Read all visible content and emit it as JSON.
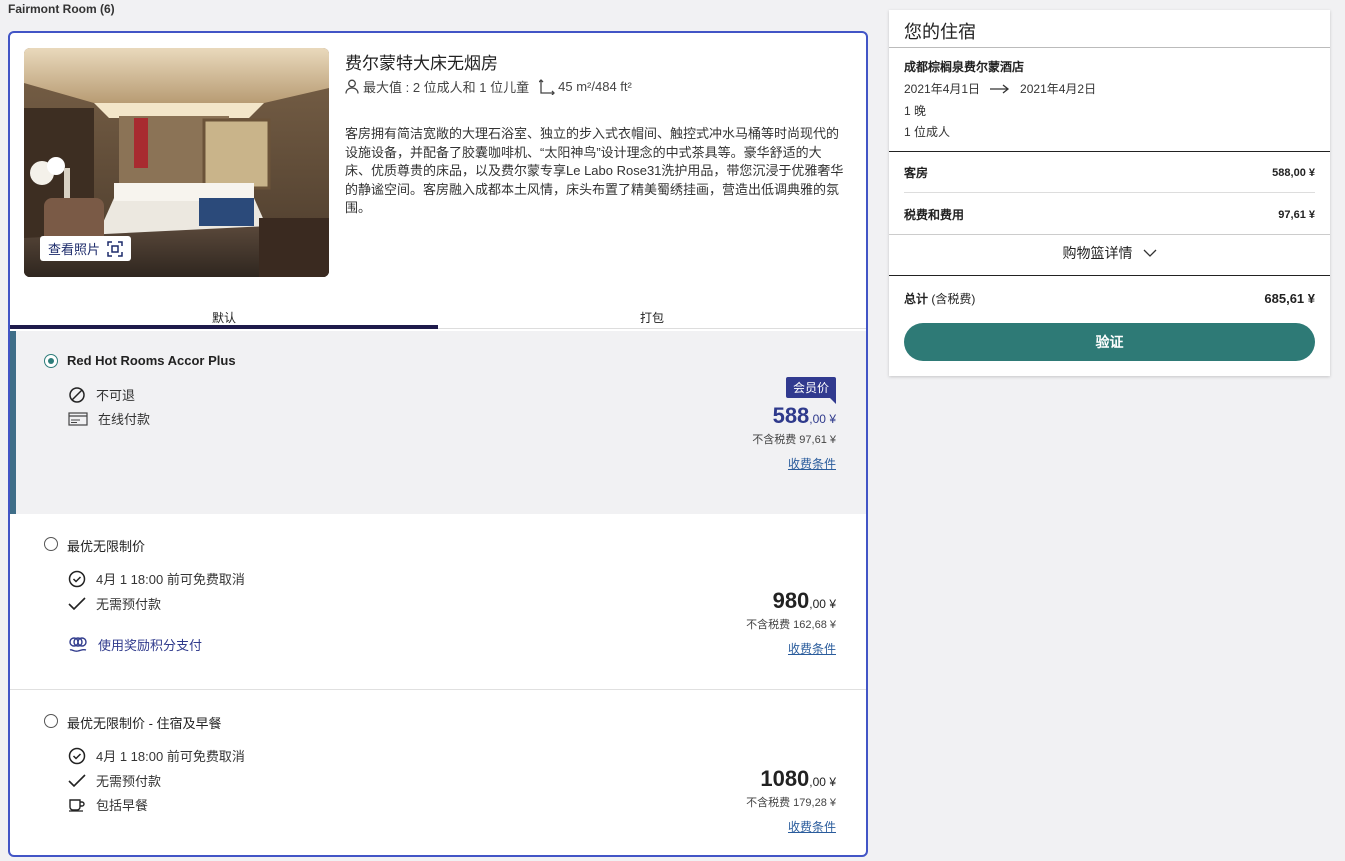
{
  "section": {
    "title": "Fairmont Room (6)"
  },
  "room": {
    "name": "费尔蒙特大床无烟房",
    "occupancy": "最大值 : 2 位成人和 1 位儿童",
    "size": "45 m²/484 ft²",
    "description": "客房拥有简洁宽敞的大理石浴室、独立的步入式衣帽间、触控式冲水马桶等时尚现代的设施设备，并配备了胶囊咖啡机、“太阳神鸟”设计理念的中式茶具等。豪华舒适的大床、优质尊贵的床品，以及费尔蒙专享Le Labo Rose31洗护用品，带您沉浸于优雅奢华的静谧空间。客房融入成都本土风情，床头布置了精美蜀绣挂画，营造出低调典雅的氛围。",
    "view_photos_label": "查看照片"
  },
  "tabs": [
    {
      "label": "默认",
      "active": true
    },
    {
      "label": "打包",
      "active": false
    }
  ],
  "rates": [
    {
      "name": "Red Hot Rooms Accor Plus",
      "selected": true,
      "features": [
        {
          "icon": "no-refund-icon",
          "text": "不可退"
        },
        {
          "icon": "card-icon",
          "text": "在线付款"
        }
      ],
      "badge": "会员价",
      "price_int": "588",
      "price_dec": ",00 ¥",
      "tax_note": "不含税费 97,61 ¥",
      "terms_label": "收费条件"
    },
    {
      "name": "最优无限制价",
      "selected": false,
      "features": [
        {
          "icon": "clock-check-icon",
          "text": "4月 1 18:00 前可免费取消"
        },
        {
          "icon": "check-icon",
          "text": "无需预付款"
        },
        {
          "icon": "rewards-icon",
          "text": "使用奖励积分支付"
        }
      ],
      "price_int": "980",
      "price_dec": ",00 ¥",
      "tax_note": "不含税费 162,68 ¥",
      "terms_label": "收费条件"
    },
    {
      "name": "最优无限制价 - 住宿及早餐",
      "selected": false,
      "features": [
        {
          "icon": "clock-check-icon",
          "text": "4月 1 18:00 前可免费取消"
        },
        {
          "icon": "check-icon",
          "text": "无需预付款"
        },
        {
          "icon": "breakfast-icon",
          "text": "包括早餐"
        }
      ],
      "price_int": "1080",
      "price_dec": ",00 ¥",
      "tax_note": "不含税费 179,28 ¥",
      "terms_label": "收费条件"
    }
  ],
  "stay": {
    "title": "您的住宿",
    "hotel": "成都棕榈泉费尔蒙酒店",
    "checkin": "2021年4月1日",
    "checkout": "2021年4月2日",
    "nights": "1 晚",
    "guests": "1 位成人",
    "room_label": "客房",
    "room_price": "588,00 ¥",
    "tax_label": "税费和费用",
    "tax_price": "97,61 ¥",
    "cart_label": "购物篮详情",
    "total_label": "总计",
    "total_note": "(含税费)",
    "total_price": "685,61 ¥",
    "verify_label": "验证"
  },
  "colors": {
    "accent_border": "#4255c6",
    "member_price": "#2f3a8c",
    "verify_button": "#2e7a76",
    "selected_bar": "#3f6e88"
  }
}
